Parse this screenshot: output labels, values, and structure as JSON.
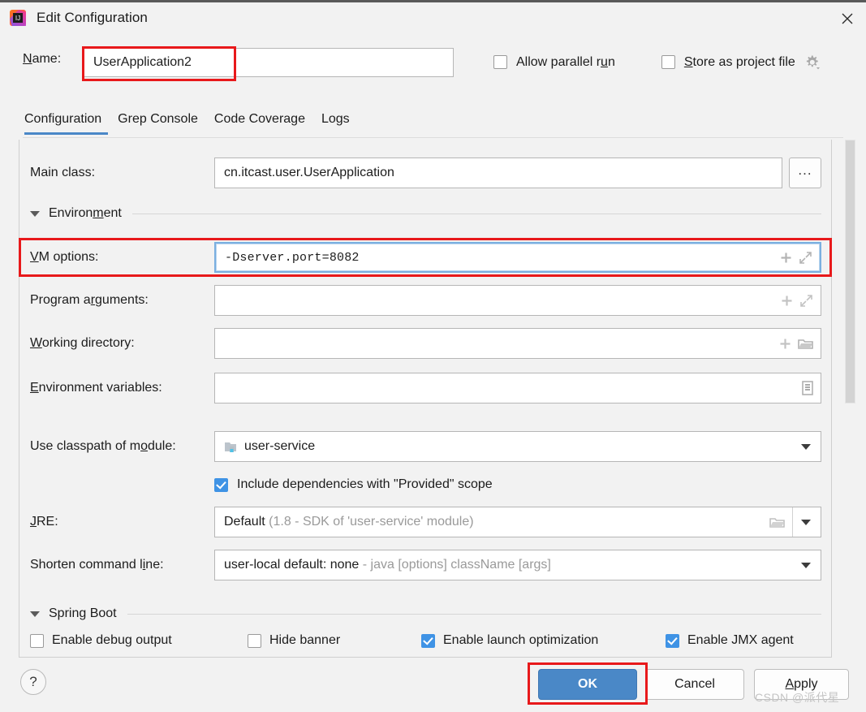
{
  "window": {
    "title": "Edit Configuration",
    "app_icon": "intellij-idea-icon",
    "close_icon": "close-icon"
  },
  "name_row": {
    "label": "Name:",
    "value": "UserApplication2",
    "placeholder": ""
  },
  "top_options": {
    "allow_parallel_run": {
      "label": "Allow parallel run",
      "checked": false
    },
    "store_as_project_file": {
      "label": "Store as project file",
      "checked": false
    },
    "gear_icon": "gear-icon"
  },
  "tabs": [
    {
      "label": "Configuration",
      "active": true
    },
    {
      "label": "Grep Console",
      "active": false
    },
    {
      "label": "Code Coverage",
      "active": false
    },
    {
      "label": "Logs",
      "active": false
    }
  ],
  "form": {
    "main_class": {
      "label": "Main class:",
      "value": "cn.itcast.user.UserApplication",
      "browse_label": "...",
      "browse_icon": "ellipsis-icon"
    },
    "environment_section": {
      "label": "Environment",
      "expanded": true
    },
    "vm_options": {
      "label": "VM options:",
      "value": "-Dserver.port=8082",
      "focused": true,
      "add_icon": "plus-icon",
      "expand_icon": "expand-icon"
    },
    "program_arguments": {
      "label": "Program arguments:",
      "value": "",
      "add_icon": "plus-icon",
      "expand_icon": "expand-icon"
    },
    "working_directory": {
      "label": "Working directory:",
      "value": "",
      "add_icon": "plus-icon",
      "folder_icon": "folder-icon"
    },
    "environment_variables": {
      "label": "Environment variables:",
      "value": "",
      "list_icon": "document-list-icon"
    },
    "classpath_module": {
      "label": "Use classpath of module:",
      "value": "user-service",
      "module_icon": "module-folder-icon",
      "dropdown_icon": "chevron-down-icon"
    },
    "include_provided": {
      "label": "Include dependencies with \"Provided\" scope",
      "checked": true
    },
    "jre": {
      "label": "JRE:",
      "value": "Default",
      "value_hint": "(1.8 - SDK of 'user-service' module)",
      "folder_icon": "folder-icon",
      "dropdown_icon": "chevron-down-icon"
    },
    "shorten_command_line": {
      "label": "Shorten command line:",
      "value": "user-local default: none",
      "value_hint": "- java [options] className [args]",
      "dropdown_icon": "chevron-down-icon"
    },
    "spring_boot_section": {
      "label": "Spring Boot",
      "expanded": true
    },
    "spring_boot_options": [
      {
        "label": "Enable debug output",
        "checked": false
      },
      {
        "label": "Hide banner",
        "checked": false
      },
      {
        "label": "Enable launch optimization",
        "checked": true
      },
      {
        "label": "Enable JMX agent",
        "checked": true
      }
    ]
  },
  "footer": {
    "help_label": "?",
    "ok_label": "OK",
    "cancel_label": "Cancel",
    "apply_label": "Apply"
  },
  "watermark": "CSDN @派代星",
  "colors": {
    "accent_blue": "#4a88c7",
    "checkbox_blue": "#3f93e5",
    "annotation_red": "#e8191b",
    "background": "#f2f2f2"
  }
}
